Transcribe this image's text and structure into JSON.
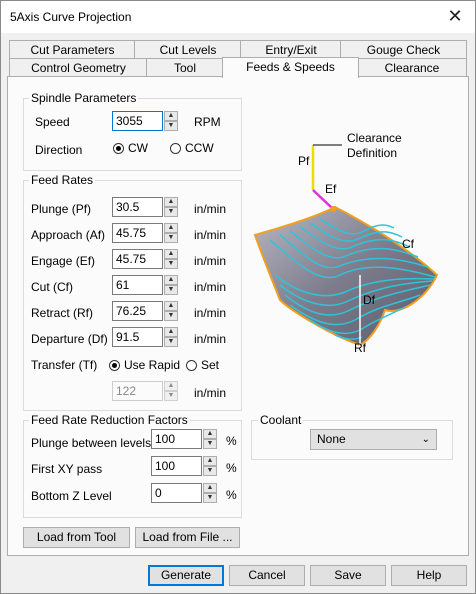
{
  "window": {
    "title": "5Axis Curve Projection",
    "close_glyph": "✕"
  },
  "tabs_row1": [
    "Cut Parameters",
    "Cut Levels",
    "Entry/Exit",
    "Gouge Check"
  ],
  "tabs_row2": [
    "Control Geometry",
    "Tool",
    "Feeds & Speeds",
    "Clearance"
  ],
  "active_tab": "Feeds & Speeds",
  "spindle": {
    "group_label": "Spindle Parameters",
    "speed_label": "Speed",
    "speed_value": "3055",
    "speed_unit": "RPM",
    "direction_label": "Direction",
    "cw_label": "CW",
    "ccw_label": "CCW",
    "direction": "CW"
  },
  "feed_rates": {
    "group_label": "Feed Rates",
    "rows": [
      {
        "label": "Plunge (Pf)",
        "value": "30.5",
        "unit": "in/min"
      },
      {
        "label": "Approach (Af)",
        "value": "45.75",
        "unit": "in/min"
      },
      {
        "label": "Engage (Ef)",
        "value": "45.75",
        "unit": "in/min"
      },
      {
        "label": "Cut (Cf)",
        "value": "61",
        "unit": "in/min"
      },
      {
        "label": "Retract (Rf)",
        "value": "76.25",
        "unit": "in/min"
      },
      {
        "label": "Departure  (Df)",
        "value": "91.5",
        "unit": "in/min"
      }
    ],
    "transfer_label": "Transfer (Tf)",
    "use_rapid_label": "Use Rapid",
    "set_label": "Set",
    "transfer_mode": "Use Rapid",
    "transfer_value": "122",
    "transfer_unit": "in/min"
  },
  "reduction": {
    "group_label": "Feed Rate Reduction Factors",
    "rows": [
      {
        "label": "Plunge between levels",
        "value": "100",
        "unit": "%"
      },
      {
        "label": "First XY pass",
        "value": "100",
        "unit": "%"
      },
      {
        "label": "Bottom Z Level",
        "value": "0",
        "unit": "%"
      }
    ]
  },
  "coolant": {
    "group_label": "Coolant",
    "value": "None"
  },
  "diagram": {
    "clearance_label": "Clearance\nDefinition",
    "pf": "Pf",
    "ef": "Ef",
    "cf": "Cf",
    "df": "Df",
    "rf": "Rf",
    "colors": {
      "surface": "#8a8a98",
      "passes": "#2ec4d8",
      "plunge": "#e8e000",
      "engage": "#e030e0",
      "edge": "#f0a020"
    }
  },
  "buttons": {
    "load_from_tool": "Load from Tool",
    "load_from_file": "Load from File ...",
    "generate": "Generate",
    "cancel": "Cancel",
    "save": "Save",
    "help": "Help"
  }
}
